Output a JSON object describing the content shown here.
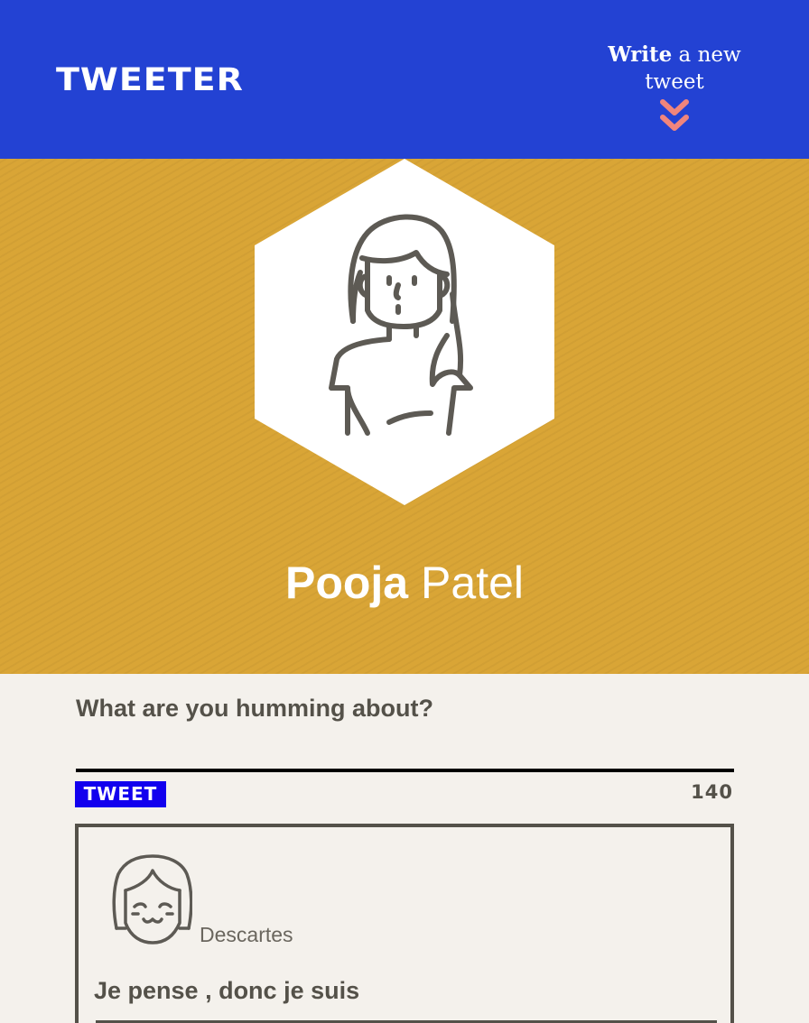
{
  "header": {
    "brand": "TWEETER",
    "write_bold": "Write",
    "write_rest": " a new tweet",
    "chevron_icon": "double-chevron-down-icon",
    "colors": {
      "background": "#2342d3",
      "chevron": "#f0857c"
    }
  },
  "profile": {
    "first_name": "Pooja",
    "last_name": "Patel",
    "avatar_icon": "woman-avatar-icon",
    "colors": {
      "background": "#d9a536"
    }
  },
  "compose": {
    "label": "What are you humming about?",
    "input_value": "",
    "input_placeholder": "",
    "submit_label": "TWEET",
    "counter": "140",
    "colors": {
      "submit_background": "#1200ee"
    }
  },
  "tweets": [
    {
      "avatar_icon": "smiling-girl-avatar-icon",
      "handle": "Descartes",
      "text": "Je pense , donc je suis"
    }
  ]
}
